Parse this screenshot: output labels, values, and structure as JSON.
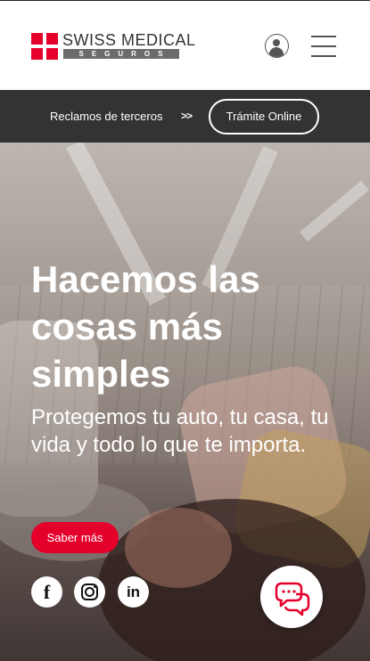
{
  "brand": {
    "name": "SWISS MEDICAL",
    "sub": "SEGUROS",
    "accent_color": "#e4002b"
  },
  "header": {
    "user_icon": "user-circle-icon",
    "menu_icon": "hamburger-menu-icon"
  },
  "topbar": {
    "claims_label": "Reclamos de terceros",
    "arrows": ">>",
    "online_button": "Trámite Online",
    "background": "#333333"
  },
  "hero": {
    "title": "Hacemos las cosas más simples",
    "subtitle": "Protegemos tu auto, tu casa, tu vida y todo lo que te importa.",
    "cta_label": "Saber más"
  },
  "social": [
    {
      "name": "facebook",
      "icon": "facebook-icon",
      "glyph": "f"
    },
    {
      "name": "instagram",
      "icon": "instagram-icon"
    },
    {
      "name": "linkedin",
      "icon": "linkedin-icon",
      "glyph": "in"
    }
  ],
  "chat": {
    "icon": "chat-bubbles-icon"
  }
}
